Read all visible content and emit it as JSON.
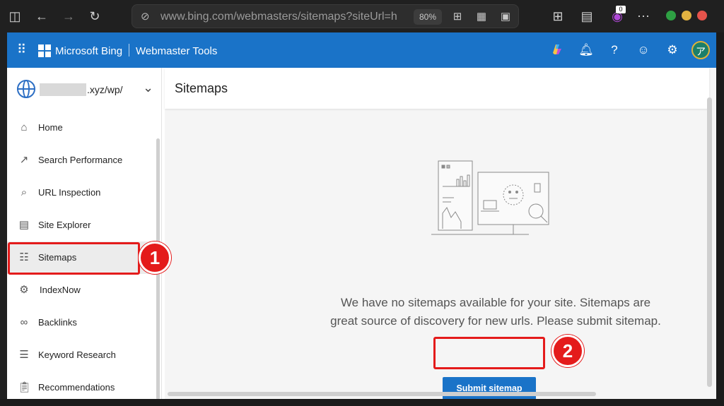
{
  "browser": {
    "url": "www.bing.com/webmasters/sitemaps?siteUrl=htt",
    "zoom": "80%",
    "extension_badge": "0",
    "window_dots": {
      "min": "#2ea043",
      "max": "#e3b341",
      "close": "#e5534b"
    }
  },
  "topbar": {
    "brand": "Microsoft Bing",
    "product": "Webmaster Tools",
    "avatar_initial": "ア",
    "accent": "#1a73c8"
  },
  "sidebar": {
    "site": ".xyz/wp/",
    "items": [
      {
        "label": "Home",
        "icon": "home-icon"
      },
      {
        "label": "Search Performance",
        "icon": "trend-icon"
      },
      {
        "label": "URL Inspection",
        "icon": "search-icon"
      },
      {
        "label": "Site Explorer",
        "icon": "document-icon"
      },
      {
        "label": "Sitemaps",
        "icon": "sitemap-icon"
      },
      {
        "label": "IndexNow",
        "icon": "gear-icon"
      },
      {
        "label": "Backlinks",
        "icon": "link-icon"
      },
      {
        "label": "Keyword Research",
        "icon": "list-icon"
      },
      {
        "label": "Recommendations",
        "icon": "clipboard-icon"
      }
    ]
  },
  "main": {
    "title": "Sitemaps",
    "empty_message": "We have no sitemaps available for your site. Sitemaps are great source of discovery for new urls. Please submit sitemap.",
    "submit_label": "Submit sitemap"
  },
  "annotations": {
    "step1": "1",
    "step2": "2",
    "highlight_color": "#e41b1b"
  }
}
